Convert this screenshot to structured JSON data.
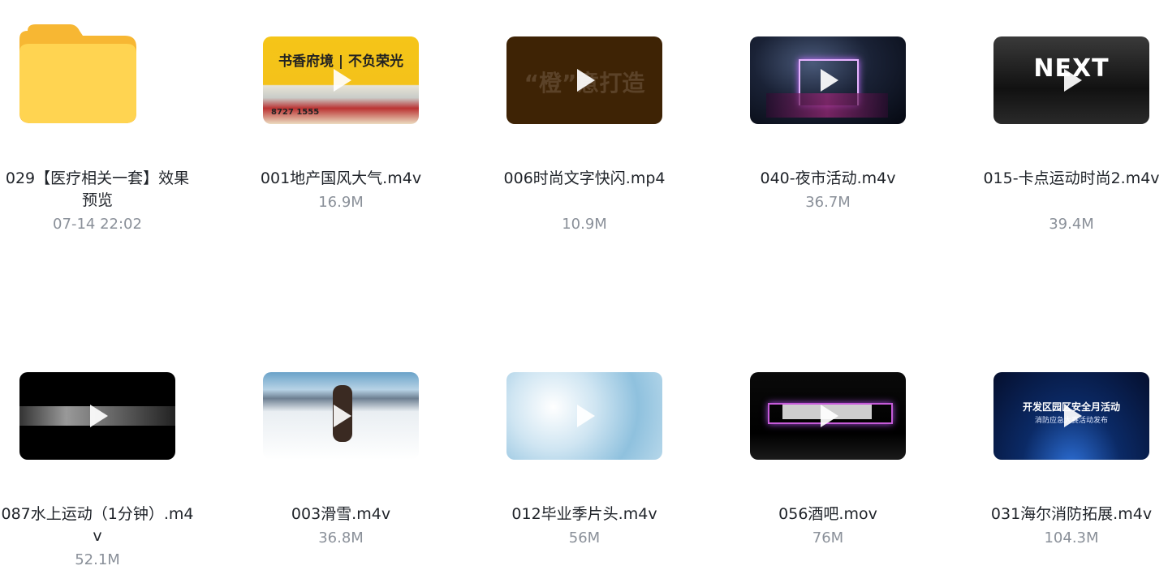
{
  "items": [
    {
      "name": "029【医疗相关一套】效果预览",
      "meta": "07-14 22:02",
      "type": "folder"
    },
    {
      "name": "001地产国风大气.m4v",
      "meta": "16.9M",
      "type": "video",
      "thumb": "realestate"
    },
    {
      "name": "006时尚文字快闪.mp4",
      "meta": "10.9M",
      "type": "video",
      "thumb": "orange",
      "thumb_text": "“橙”意打造"
    },
    {
      "name": "040-夜市活动.m4v",
      "meta": "36.7M",
      "type": "video",
      "thumb": "nightmarket"
    },
    {
      "name": "015-卡点运动时尚2.m4v",
      "meta": "39.4M",
      "type": "video",
      "thumb": "next",
      "thumb_text": "NEXT"
    },
    {
      "name": "087水上运动（1分钟）.m4v",
      "meta": "52.1M",
      "type": "video",
      "thumb": "water"
    },
    {
      "name": "003滑雪.m4v",
      "meta": "36.8M",
      "type": "video",
      "thumb": "ski"
    },
    {
      "name": "012毕业季片头.m4v",
      "meta": "56M",
      "type": "video",
      "thumb": "clouds"
    },
    {
      "name": "056酒吧.mov",
      "meta": "76M",
      "type": "video",
      "thumb": "bar"
    },
    {
      "name": "031海尔消防拓展.m4v",
      "meta": "104.3M",
      "type": "video",
      "thumb": "fire",
      "thumb_text": "开发区园区安全月活动",
      "thumb_subtext": "消防应急大赛活动发布"
    }
  ]
}
